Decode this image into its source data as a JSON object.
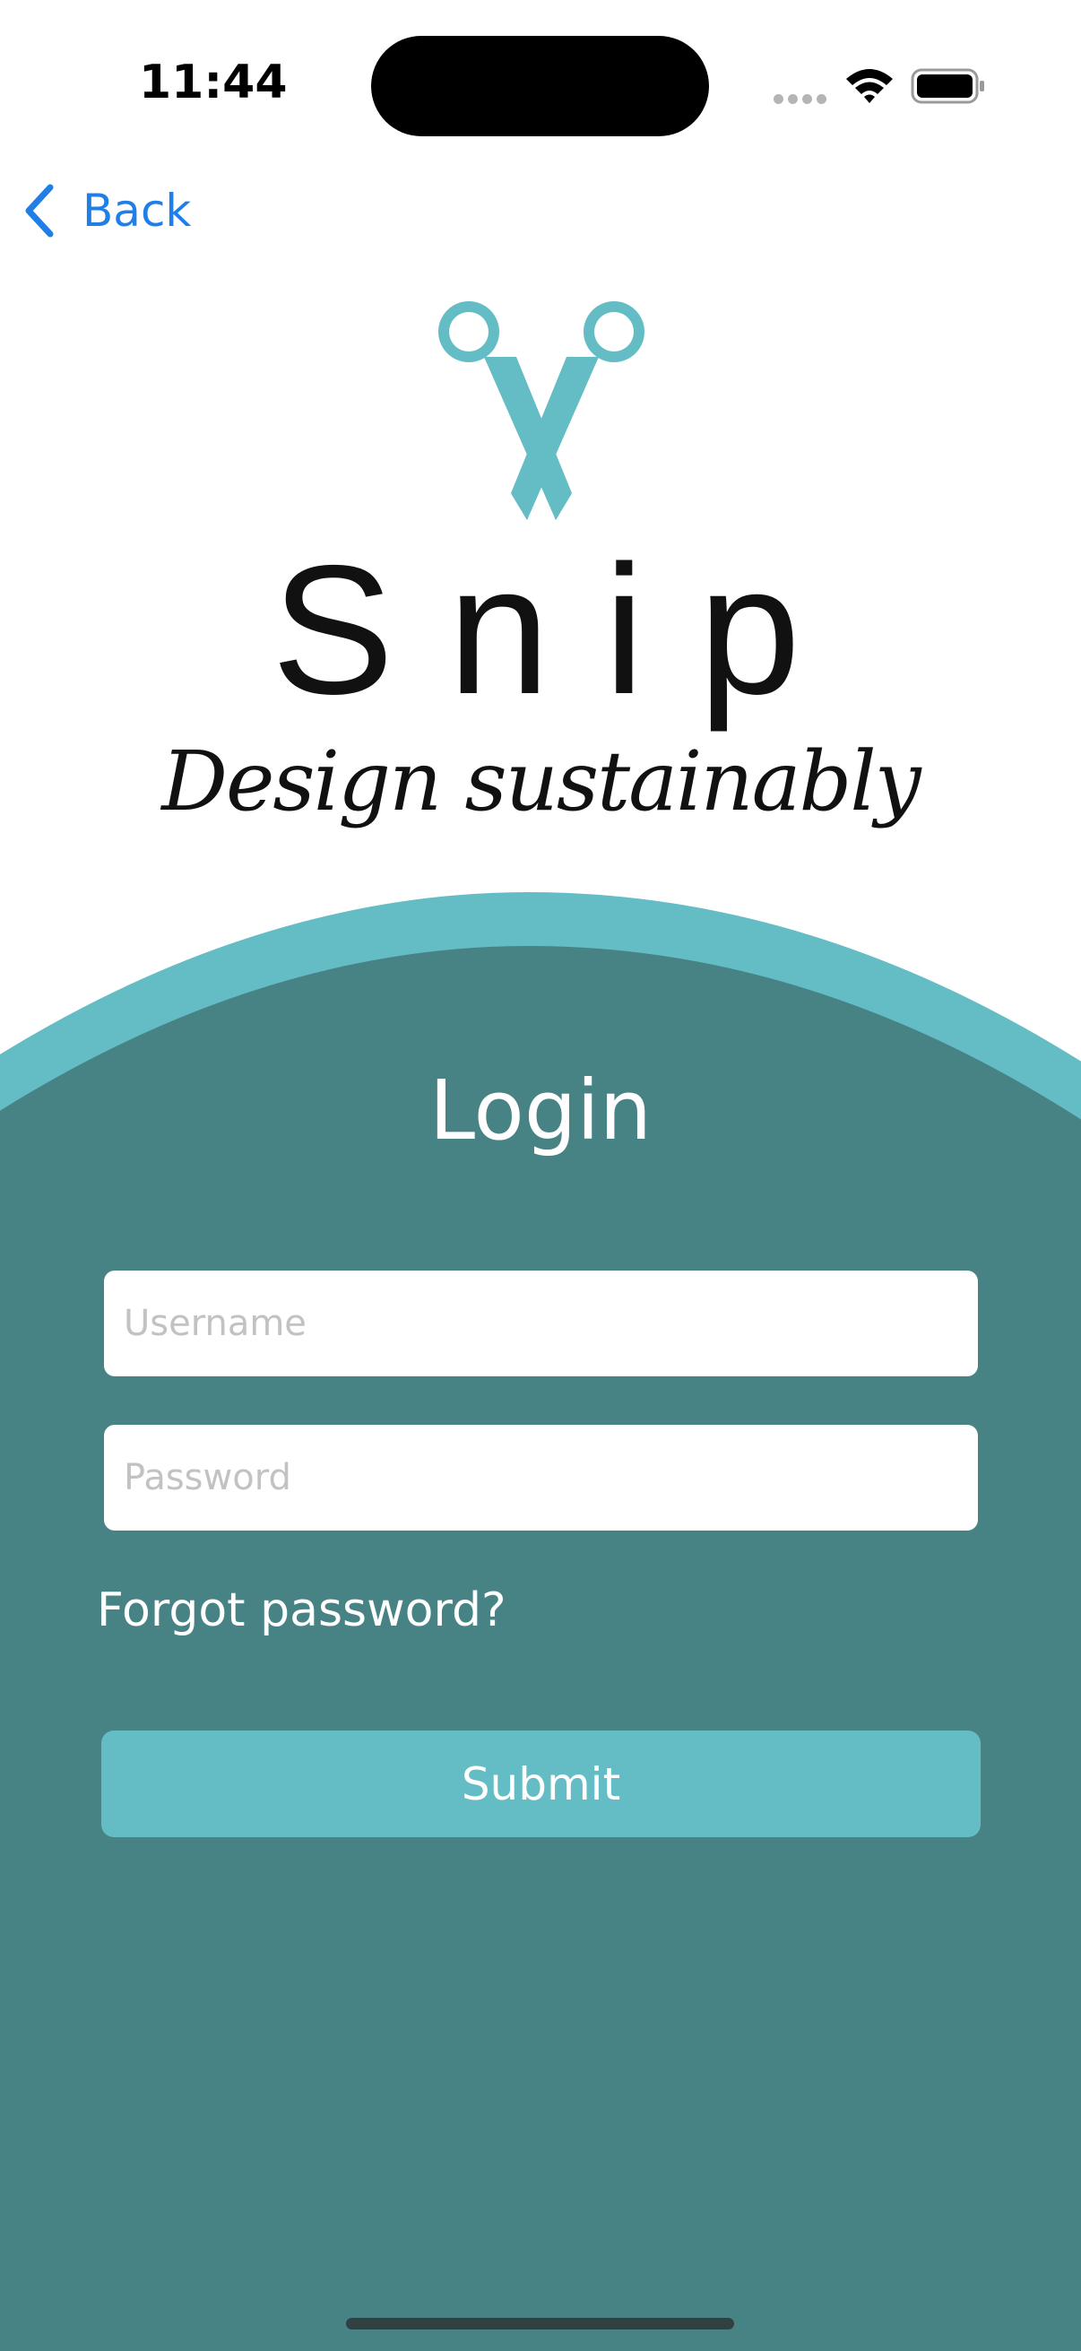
{
  "status_bar": {
    "time": "11:44"
  },
  "nav": {
    "back_label": "Back"
  },
  "logo": {
    "icon": "scissors-icon",
    "brand": "Snip",
    "tagline": "Design sustainably"
  },
  "login": {
    "title": "Login",
    "username_placeholder": "Username",
    "password_placeholder": "Password",
    "forgot_label": "Forgot password?",
    "submit_label": "Submit"
  },
  "colors": {
    "panel": "#478285",
    "panel_rim": "#64bcc4",
    "accent": "#64bcc4",
    "link": "#1f7fe6"
  }
}
